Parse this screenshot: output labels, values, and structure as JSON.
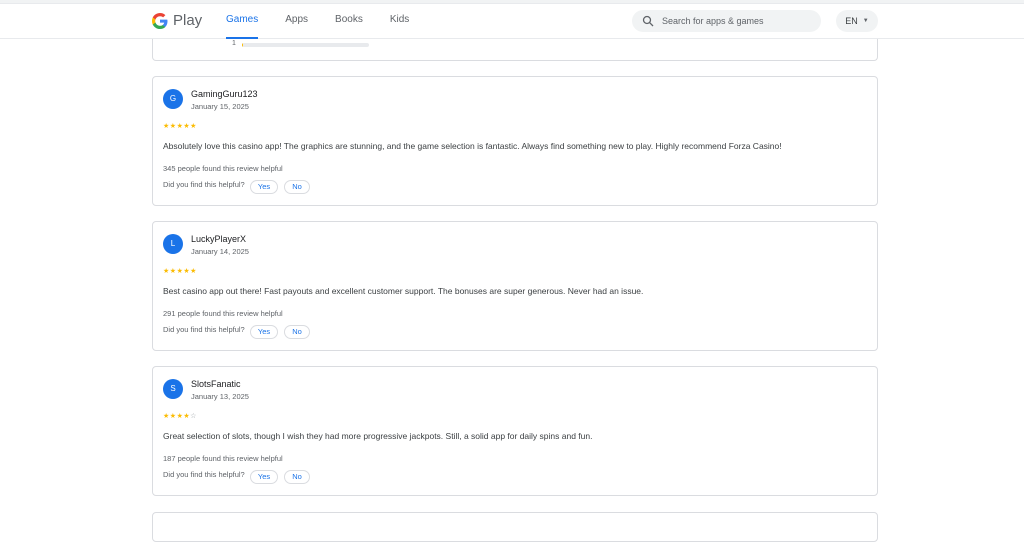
{
  "header": {
    "logo_text": "Play",
    "nav": [
      "Games",
      "Apps",
      "Books",
      "Kids"
    ],
    "active_nav": "Games",
    "search_placeholder": "Search for apps & games",
    "language": "EN"
  },
  "rating_breakdown": {
    "label": "1",
    "fill_fraction": 0.01
  },
  "reviews": [
    {
      "initial": "G",
      "author": "GamingGuru123",
      "date": "January 15, 2025",
      "rating": 5,
      "text": "Absolutely love this casino app! The graphics are stunning, and the game selection is fantastic. Always find something new to play. Highly recommend Forza Casino!",
      "helpful": "345 people found this review helpful",
      "question": "Did you find this helpful?",
      "yes": "Yes",
      "no": "No"
    },
    {
      "initial": "L",
      "author": "LuckyPlayerX",
      "date": "January 14, 2025",
      "rating": 5,
      "text": "Best casino app out there! Fast payouts and excellent customer support. The bonuses are super generous. Never had an issue.",
      "helpful": "291 people found this review helpful",
      "question": "Did you find this helpful?",
      "yes": "Yes",
      "no": "No"
    },
    {
      "initial": "S",
      "author": "SlotsFanatic",
      "date": "January 13, 2025",
      "rating": 4,
      "text": "Great selection of slots, though I wish they had more progressive jackpots. Still, a solid app for daily spins and fun.",
      "helpful": "187 people found this review helpful",
      "question": "Did you find this helpful?",
      "yes": "Yes",
      "no": "No"
    }
  ],
  "colors": {
    "accent": "#1a73e8",
    "star": "#fbbc04",
    "border": "#dadce0"
  }
}
